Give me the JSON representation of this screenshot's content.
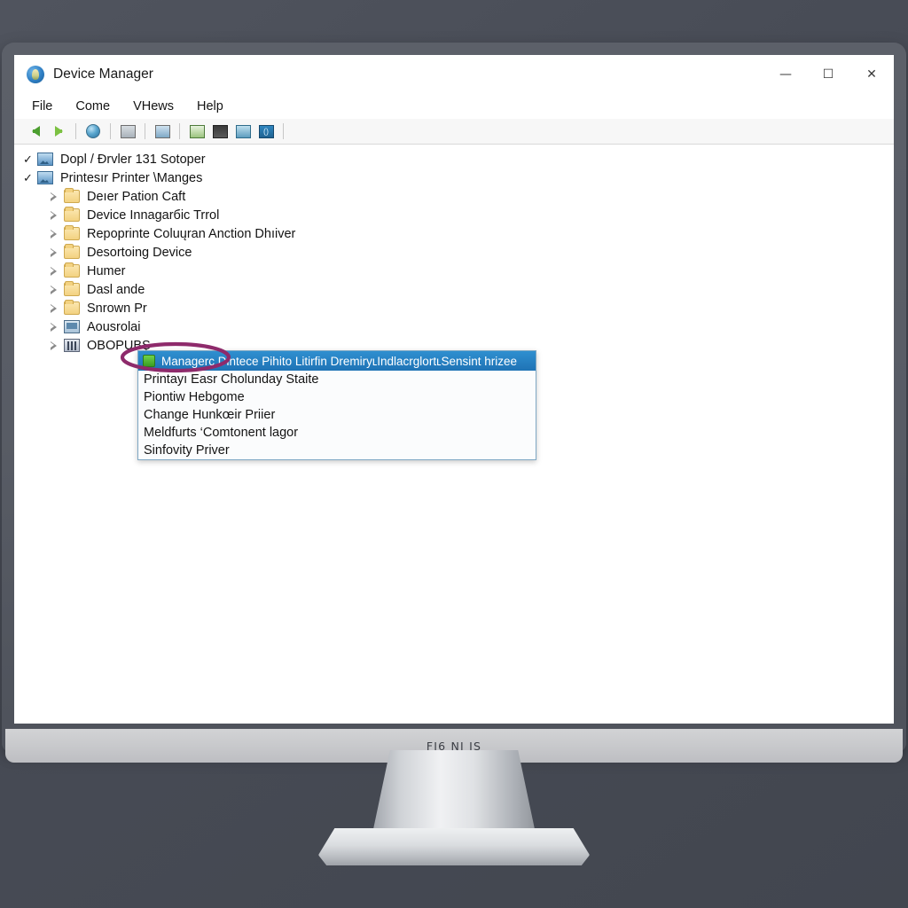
{
  "window": {
    "title": "Device Manager",
    "app_icon": "device-manager-icon",
    "controls": {
      "minimize": "—",
      "maximize": "☐",
      "close": "✕"
    }
  },
  "menubar": {
    "items": [
      "File",
      "Come",
      "VHews",
      "Help"
    ]
  },
  "toolbar": {
    "icons": [
      "back-arrow-icon",
      "forward-arrow-icon",
      "globe-icon",
      "properties-icon",
      "update-driver-icon",
      "scan-hardware-icon",
      "print-icon",
      "monitor-icon",
      "code-icon"
    ]
  },
  "tree": {
    "items": [
      {
        "label": "Dopl / Đrvler 131 Sotoper",
        "level": 0,
        "icon": "image-icon",
        "marker": "check"
      },
      {
        "label": "Printesır Printer \\Manges",
        "level": 0,
        "icon": "image-icon",
        "marker": "check"
      },
      {
        "label": "Deıer Pation Caft",
        "level": 1,
        "icon": "folder-icon",
        "marker": "expander"
      },
      {
        "label": "Device Innagarбic Trrol",
        "level": 1,
        "icon": "folder-icon",
        "marker": "expander"
      },
      {
        "label": "Repoprinte Coluųran Anction Dhıiver",
        "level": 1,
        "icon": "folder-icon",
        "marker": "expander"
      },
      {
        "label": "Desortoing Device",
        "level": 1,
        "icon": "folder-icon",
        "marker": "expander"
      },
      {
        "label": "Humer",
        "level": 1,
        "icon": "folder-icon",
        "marker": "expander"
      },
      {
        "label": "Dasl ande",
        "level": 1,
        "icon": "folder-icon",
        "marker": "expander"
      },
      {
        "label": "Snrown Pr",
        "level": 1,
        "icon": "folder-icon",
        "marker": "expander"
      },
      {
        "label": "Aousrolai",
        "level": 1,
        "icon": "monitor-icon",
        "marker": "expander"
      },
      {
        "label": "OBOPUBŞ",
        "level": 1,
        "icon": "chip-icon",
        "marker": "expander"
      }
    ]
  },
  "context_menu": {
    "header": "Managerc Dintece Pihito Litirfin DremiryʟIndlacrglortʟSensint hrizee",
    "header_icon": "green-square-icon",
    "items": [
      "Printayı Easr Cholunday Staite",
      "Piontiw Hebgome",
      "Change Hunkœir Priier",
      "Meldfurts ‘Comtonent lagor",
      "Sinfovity Priver"
    ]
  },
  "annotation": {
    "shape": "ellipse-highlight",
    "color": "#8e2a6b"
  },
  "monitor": {
    "chin_label": "FI6 NI IS"
  },
  "colors": {
    "accent": "#1f73b5",
    "background": "#474b55",
    "bezel": "#585c65",
    "chin": "#c6c7ca",
    "annotation": "#8e2a6b"
  }
}
